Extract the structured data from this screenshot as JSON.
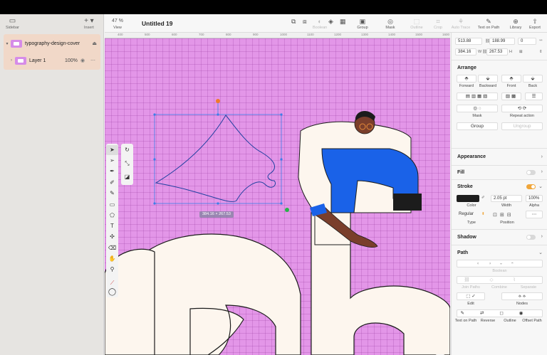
{
  "sidebar": {
    "label": "Sidebar",
    "insert_label": "Insert",
    "layers": [
      {
        "name": "typography-design-cover"
      },
      {
        "name": "Layer 1",
        "opacity": "100%"
      }
    ]
  },
  "toolbar": {
    "zoom": "47 %",
    "zoom_label": "View",
    "title": "Untitled 19",
    "items": [
      {
        "label": "Boolean",
        "enabled": false
      },
      {
        "label": "Group",
        "enabled": true
      },
      {
        "label": "Mask",
        "enabled": true
      },
      {
        "label": "Outline",
        "enabled": false
      },
      {
        "label": "Crop",
        "enabled": false
      },
      {
        "label": "Auto Trace",
        "enabled": false
      },
      {
        "label": "Text on Path",
        "enabled": true
      },
      {
        "label": "Library",
        "enabled": true
      },
      {
        "label": "Export",
        "enabled": true
      }
    ]
  },
  "ruler": {
    "ticks": [
      "400",
      "500",
      "600",
      "700",
      "800",
      "900",
      "1000",
      "1100",
      "1200",
      "1300",
      "1400",
      "1500",
      "1600"
    ]
  },
  "canvas": {
    "selection_size": "384.16 × 267.53",
    "help": "?",
    "colors": {
      "background": "#e396e8",
      "letter_fill": "#fdf6ee",
      "shirt_blue": "#1a62e8",
      "skin": "#7a3e2b"
    }
  },
  "inspector": {
    "x": "513.88",
    "y": "188.99",
    "w": "384.16",
    "h": "267.53",
    "rotation": "0",
    "w_label": "W",
    "h_label": "H",
    "arrange": {
      "title": "Arrange",
      "order": [
        "Forward",
        "Backward",
        "Front",
        "Back"
      ],
      "mask_label": "Mask",
      "repeat_label": "Repeat action",
      "group_label": "Group",
      "ungroup_label": "Ungroup"
    },
    "appearance": {
      "title": "Appearance"
    },
    "fill": {
      "title": "Fill",
      "enabled": false
    },
    "stroke": {
      "title": "Stroke",
      "enabled": true,
      "width": "2.05 pt",
      "alpha": "100%",
      "color_label": "Color",
      "width_label": "Width",
      "alpha_label": "Alpha",
      "type": "Regular",
      "type_label": "Type",
      "position_label": "Position",
      "color": "#1e1e1e"
    },
    "shadow": {
      "title": "Shadow",
      "enabled": false
    },
    "path": {
      "title": "Path",
      "boolean_label": "Boolean",
      "join_label": "Join Paths",
      "combine_label": "Combine",
      "separate_label": "Separate",
      "edit_label": "Edit",
      "nodes_label": "Nodes",
      "actions": [
        "Text on Path",
        "Reverse",
        "Outline",
        "Offset Path"
      ]
    }
  }
}
